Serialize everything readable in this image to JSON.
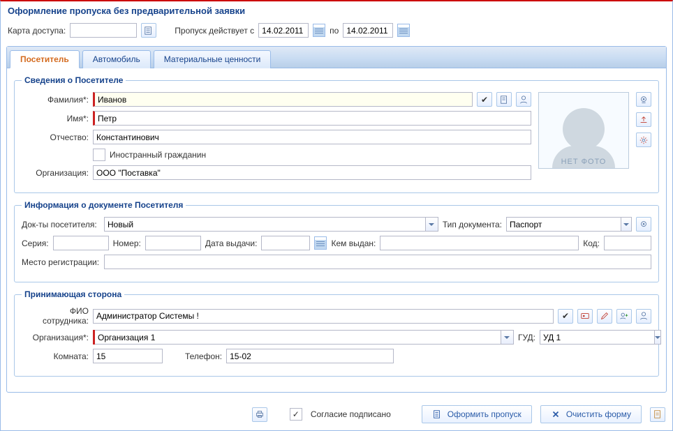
{
  "title": "Оформление пропуска без предварительной заявки",
  "topbar": {
    "card_label": "Карта доступа:",
    "card_value": "",
    "valid_label": "Пропуск действует с",
    "date_from": "14.02.2011",
    "to_label": "по",
    "date_to": "14.02.2011"
  },
  "tabs": [
    {
      "label": "Посетитель",
      "active": true
    },
    {
      "label": "Автомобиль",
      "active": false
    },
    {
      "label": "Материальные ценности",
      "active": false
    }
  ],
  "visitor": {
    "legend": "Сведения о Посетителе",
    "surname_label": "Фамилия*:",
    "surname": "Иванов",
    "name_label": "Имя*:",
    "name": "Петр",
    "patronymic_label": "Отчество:",
    "patronymic": "Константинович",
    "foreigner_label": "Иностранный гражданин",
    "org_label": "Организация:",
    "org": "ООО \"Поставка\"",
    "photo_placeholder": "НЕТ ФОТО"
  },
  "docs": {
    "legend": "Информация о документе Посетителя",
    "docs_label": "Док-ты посетителя:",
    "docs_value": "Новый",
    "type_label": "Тип документа:",
    "type_value": "Паспорт",
    "series_label": "Серия:",
    "series": "",
    "number_label": "Номер:",
    "number": "",
    "issue_date_label": "Дата выдачи:",
    "issue_date": "",
    "issued_by_label": "Кем выдан:",
    "issued_by": "",
    "code_label": "Код:",
    "code": "",
    "reg_label": "Место регистрации:",
    "reg": ""
  },
  "host": {
    "legend": "Принимающая сторона",
    "fio_label": "ФИО сотрудника:",
    "fio": "Администратор Системы !",
    "org_label": "Организация*:",
    "org": "Организация 1",
    "gud_label": "ГУД:",
    "gud": "УД 1",
    "room_label": "Комната:",
    "room": "15",
    "phone_label": "Телефон:",
    "phone": "15-02"
  },
  "footer": {
    "consent_label": "Согласие подписано",
    "submit": "Оформить пропуск",
    "clear": "Очистить форму"
  }
}
